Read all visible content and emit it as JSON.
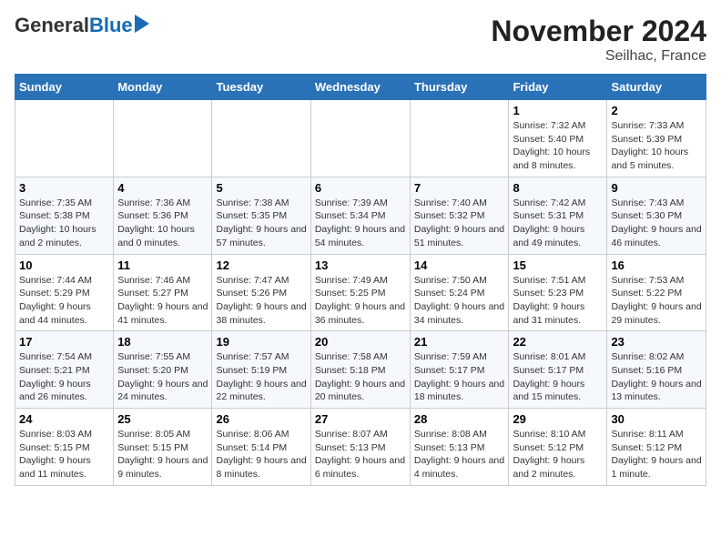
{
  "logo": {
    "general": "General",
    "blue": "Blue"
  },
  "header": {
    "title": "November 2024",
    "subtitle": "Seilhac, France"
  },
  "days_of_week": [
    "Sunday",
    "Monday",
    "Tuesday",
    "Wednesday",
    "Thursday",
    "Friday",
    "Saturday"
  ],
  "weeks": [
    [
      {
        "day": "",
        "info": ""
      },
      {
        "day": "",
        "info": ""
      },
      {
        "day": "",
        "info": ""
      },
      {
        "day": "",
        "info": ""
      },
      {
        "day": "",
        "info": ""
      },
      {
        "day": "1",
        "info": "Sunrise: 7:32 AM\nSunset: 5:40 PM\nDaylight: 10 hours and 8 minutes."
      },
      {
        "day": "2",
        "info": "Sunrise: 7:33 AM\nSunset: 5:39 PM\nDaylight: 10 hours and 5 minutes."
      }
    ],
    [
      {
        "day": "3",
        "info": "Sunrise: 7:35 AM\nSunset: 5:38 PM\nDaylight: 10 hours and 2 minutes."
      },
      {
        "day": "4",
        "info": "Sunrise: 7:36 AM\nSunset: 5:36 PM\nDaylight: 10 hours and 0 minutes."
      },
      {
        "day": "5",
        "info": "Sunrise: 7:38 AM\nSunset: 5:35 PM\nDaylight: 9 hours and 57 minutes."
      },
      {
        "day": "6",
        "info": "Sunrise: 7:39 AM\nSunset: 5:34 PM\nDaylight: 9 hours and 54 minutes."
      },
      {
        "day": "7",
        "info": "Sunrise: 7:40 AM\nSunset: 5:32 PM\nDaylight: 9 hours and 51 minutes."
      },
      {
        "day": "8",
        "info": "Sunrise: 7:42 AM\nSunset: 5:31 PM\nDaylight: 9 hours and 49 minutes."
      },
      {
        "day": "9",
        "info": "Sunrise: 7:43 AM\nSunset: 5:30 PM\nDaylight: 9 hours and 46 minutes."
      }
    ],
    [
      {
        "day": "10",
        "info": "Sunrise: 7:44 AM\nSunset: 5:29 PM\nDaylight: 9 hours and 44 minutes."
      },
      {
        "day": "11",
        "info": "Sunrise: 7:46 AM\nSunset: 5:27 PM\nDaylight: 9 hours and 41 minutes."
      },
      {
        "day": "12",
        "info": "Sunrise: 7:47 AM\nSunset: 5:26 PM\nDaylight: 9 hours and 38 minutes."
      },
      {
        "day": "13",
        "info": "Sunrise: 7:49 AM\nSunset: 5:25 PM\nDaylight: 9 hours and 36 minutes."
      },
      {
        "day": "14",
        "info": "Sunrise: 7:50 AM\nSunset: 5:24 PM\nDaylight: 9 hours and 34 minutes."
      },
      {
        "day": "15",
        "info": "Sunrise: 7:51 AM\nSunset: 5:23 PM\nDaylight: 9 hours and 31 minutes."
      },
      {
        "day": "16",
        "info": "Sunrise: 7:53 AM\nSunset: 5:22 PM\nDaylight: 9 hours and 29 minutes."
      }
    ],
    [
      {
        "day": "17",
        "info": "Sunrise: 7:54 AM\nSunset: 5:21 PM\nDaylight: 9 hours and 26 minutes."
      },
      {
        "day": "18",
        "info": "Sunrise: 7:55 AM\nSunset: 5:20 PM\nDaylight: 9 hours and 24 minutes."
      },
      {
        "day": "19",
        "info": "Sunrise: 7:57 AM\nSunset: 5:19 PM\nDaylight: 9 hours and 22 minutes."
      },
      {
        "day": "20",
        "info": "Sunrise: 7:58 AM\nSunset: 5:18 PM\nDaylight: 9 hours and 20 minutes."
      },
      {
        "day": "21",
        "info": "Sunrise: 7:59 AM\nSunset: 5:17 PM\nDaylight: 9 hours and 18 minutes."
      },
      {
        "day": "22",
        "info": "Sunrise: 8:01 AM\nSunset: 5:17 PM\nDaylight: 9 hours and 15 minutes."
      },
      {
        "day": "23",
        "info": "Sunrise: 8:02 AM\nSunset: 5:16 PM\nDaylight: 9 hours and 13 minutes."
      }
    ],
    [
      {
        "day": "24",
        "info": "Sunrise: 8:03 AM\nSunset: 5:15 PM\nDaylight: 9 hours and 11 minutes."
      },
      {
        "day": "25",
        "info": "Sunrise: 8:05 AM\nSunset: 5:15 PM\nDaylight: 9 hours and 9 minutes."
      },
      {
        "day": "26",
        "info": "Sunrise: 8:06 AM\nSunset: 5:14 PM\nDaylight: 9 hours and 8 minutes."
      },
      {
        "day": "27",
        "info": "Sunrise: 8:07 AM\nSunset: 5:13 PM\nDaylight: 9 hours and 6 minutes."
      },
      {
        "day": "28",
        "info": "Sunrise: 8:08 AM\nSunset: 5:13 PM\nDaylight: 9 hours and 4 minutes."
      },
      {
        "day": "29",
        "info": "Sunrise: 8:10 AM\nSunset: 5:12 PM\nDaylight: 9 hours and 2 minutes."
      },
      {
        "day": "30",
        "info": "Sunrise: 8:11 AM\nSunset: 5:12 PM\nDaylight: 9 hours and 1 minute."
      }
    ]
  ]
}
